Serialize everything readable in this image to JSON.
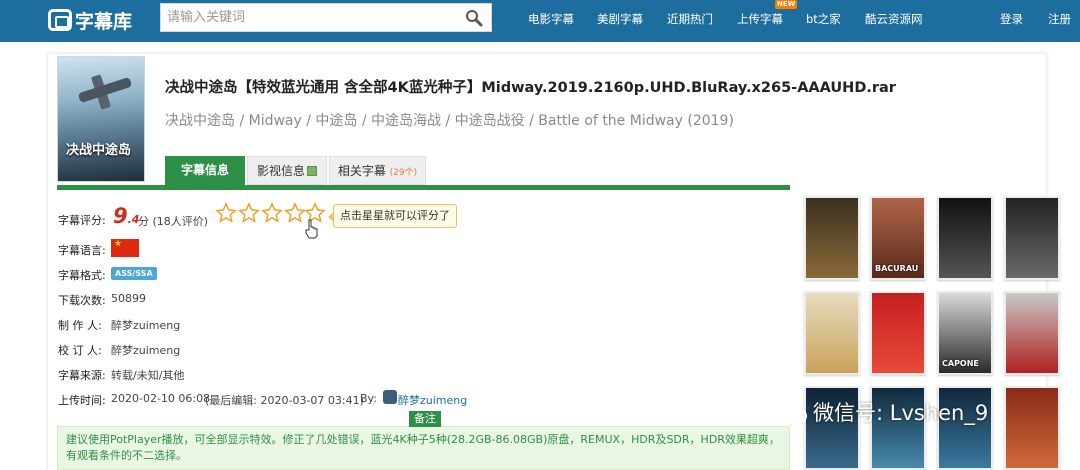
{
  "header": {
    "logo_text": "字幕库",
    "search_placeholder": "请输入关键词",
    "nav": [
      "电影字幕",
      "美剧字幕",
      "近期热门",
      "上传字幕",
      "bt之家",
      "酷云资源网"
    ],
    "new_badge": "NEW",
    "login": "登录",
    "register": "注册"
  },
  "poster_text": "决战中途岛",
  "title": "决战中途岛【特效蓝光通用 含全部4K蓝光种子】Midway.2019.2160p.UHD.BluRay.x265-AAAUHD.rar",
  "aliases": "决战中途岛 / Midway / 中途岛 / 中途岛海战 / 中途岛战役 / Battle of the Midway (2019)",
  "tabs": {
    "info": "字幕信息",
    "film": "影视信息",
    "related": "相关字幕",
    "related_count": "(29个)"
  },
  "info": {
    "rating_label": "字幕评分:",
    "rating_int": "9",
    "rating_dec": ".4",
    "rating_unit": "分 (18人评价)",
    "rating_value": 9.4,
    "rating_tip": "点击星星就可以评分了",
    "language_label": "字幕语言:",
    "format_label": "字幕格式:",
    "format_value": "ASS/SSA",
    "downloads_label": "下载次数:",
    "downloads_value": "50899",
    "author_label": "制 作 人:",
    "author_value": "醉梦zuimeng",
    "proofreader_label": "校 订 人:",
    "proofreader_value": "醉梦zuimeng",
    "source_label": "字幕来源:",
    "source_value": "转载/未知/其他",
    "upload_label": "上传时间:",
    "upload_value": "2020-02-10 06:08",
    "edit_value": "(最后编辑: 2020-03-07 03:41)",
    "by_label": "By:",
    "uploader": "醉梦zuimeng"
  },
  "note": {
    "tag": "备注",
    "text": "建议使用PotPlayer播放，可全部显示特效。修正了几处错误，蓝光4K种子5种(28.2GB-86.08GB)原盘，REMUX，HDR及SDR，HDR效果超爽，有观看条件的不二选择。"
  },
  "thumbs": [
    {
      "caption": "",
      "color1": "#3a3020",
      "color2": "#8a6a3a"
    },
    {
      "caption": "BACURAU",
      "color1": "#b0654a",
      "color2": "#5a2a1a"
    },
    {
      "caption": "",
      "color1": "#111111",
      "color2": "#555555"
    },
    {
      "caption": "",
      "color1": "#222222",
      "color2": "#6a6a6a"
    },
    {
      "caption": "",
      "color1": "#e6dcc0",
      "color2": "#c9a25a"
    },
    {
      "caption": "",
      "color1": "#c51f20",
      "color2": "#e84a3a"
    },
    {
      "caption": "CAPONE",
      "color1": "#d9d9d9",
      "color2": "#2a2a2a"
    },
    {
      "caption": "",
      "color1": "#c8c8c8",
      "color2": "#b02020"
    },
    {
      "caption": "",
      "color1": "#0c2236",
      "color2": "#3a6a8a"
    },
    {
      "caption": "",
      "color1": "#0e2a3a",
      "color2": "#4a8ab0"
    },
    {
      "caption": "",
      "color1": "#10283a",
      "color2": "#3a7aa0"
    },
    {
      "caption": "",
      "color1": "#8a2a1a",
      "color2": "#d06a3a"
    }
  ],
  "watermark": "微信号: Lvshen_9"
}
